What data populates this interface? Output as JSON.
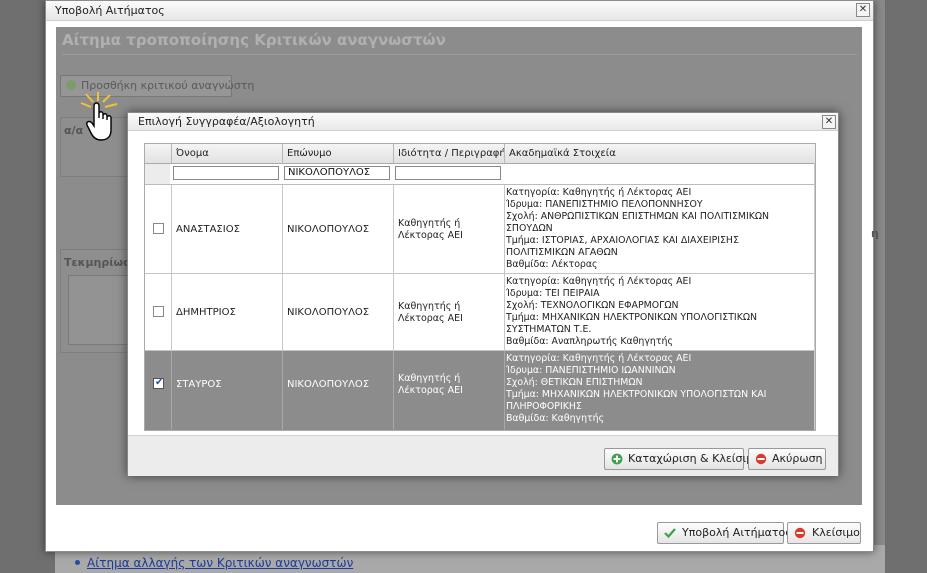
{
  "background_page": {
    "link_text": "Αίτημα αλλαγής των Κριτικών αναγνωστών"
  },
  "outer_dialog": {
    "title": "Υποβολή Αιτήματος",
    "heading": "Αίτημα τροποποίησης Κριτικών αναγνωστών",
    "add_reviewer_label": "Προσθήκη κριτικού αναγνώστη",
    "box1_label": "α/α",
    "box2_label": "Τεκμηρίωση",
    "right_label": "η",
    "submit_label": "Υποβολή Αιτήματος",
    "close_label": "Κλείσιμο"
  },
  "inner_dialog": {
    "title": "Επιλογή Συγγραφέα/Αξιολογητή",
    "columns": [
      "Όνομα",
      "Επώνυμο",
      "Ιδιότητα / Περιγραφή",
      "Ακαδημαϊκά Στοιχεία"
    ],
    "filters": {
      "first_name": "",
      "last_name": "ΝΙΚΟΛΟΠΟΥΛΟΣ",
      "role": ""
    },
    "rows": [
      {
        "selected": false,
        "first_name": "ΑΝΑΣΤΑΣΙΟΣ",
        "last_name": "ΝΙΚΟΛΟΠΟΥΛΟΣ",
        "role": "Καθηγητής ή Λέκτορας ΑΕΙ",
        "academic": [
          "Κατηγορία: Καθηγητής ή Λέκτορας ΑΕΙ",
          "Ίδρυμα: ΠΑΝΕΠΙΣΤΗΜΙΟ ΠΕΛΟΠΟΝΝΗΣΟΥ",
          "Σχολή: ΑΝΘΡΩΠΙΣΤΙΚΩΝ ΕΠΙΣΤΗΜΩΝ ΚΑΙ ΠΟΛΙΤΙΣΜΙΚΩΝ ΣΠΟΥΔΩΝ",
          "Τμήμα: ΙΣΤΟΡΙΑΣ, ΑΡΧΑΙΟΛΟΓΙΑΣ ΚΑΙ ΔΙΑΧΕΙΡΙΣΗΣ ΠΟΛΙΤΙΣΜΙΚΩΝ ΑΓΑΘΩΝ",
          "Βαθμίδα: Λέκτορας"
        ]
      },
      {
        "selected": false,
        "first_name": "ΔΗΜΗΤΡΙΟΣ",
        "last_name": "ΝΙΚΟΛΟΠΟΥΛΟΣ",
        "role": "Καθηγητής ή Λέκτορας ΑΕΙ",
        "academic": [
          "Κατηγορία: Καθηγητής ή Λέκτορας ΑΕΙ",
          "Ίδρυμα: ΤΕΙ ΠΕΙΡΑΙΑ",
          "Σχολή: ΤΕΧΝΟΛΟΓΙΚΩΝ ΕΦΑΡΜΟΓΩΝ",
          "Τμήμα: ΜΗΧΑΝΙΚΩΝ ΗΛΕΚΤΡΟΝΙΚΩΝ ΥΠΟΛΟΓΙΣΤΙΚΩΝ ΣΥΣΤΗΜΑΤΩΝ Τ.Ε.",
          "Βαθμίδα: Αναπληρωτής Καθηγητής"
        ]
      },
      {
        "selected": true,
        "first_name": "ΣΤΑΥΡΟΣ",
        "last_name": "ΝΙΚΟΛΟΠΟΥΛΟΣ",
        "role": "Καθηγητής ή Λέκτορας ΑΕΙ",
        "academic": [
          "Κατηγορία: Καθηγητής ή Λέκτορας ΑΕΙ",
          "Ίδρυμα: ΠΑΝΕΠΙΣΤΗΜΙΟ ΙΩΑΝΝΙΝΩΝ",
          "Σχολή: ΘΕΤΙΚΩΝ ΕΠΙΣΤΗΜΩΝ",
          "Τμήμα: ΜΗΧΑΝΙΚΩΝ ΗΛΕΚΤΡΟΝΙΚΩΝ ΥΠΟΛΟΓΙΣΤΩΝ ΚΑΙ ΠΛΗΡΟΦΟΡΙΚΗΣ",
          "Βαθμίδα: Καθηγητής"
        ]
      }
    ],
    "save_close_label": "Καταχώριση & Κλείσιμο",
    "cancel_label": "Ακύρωση"
  },
  "colors": {
    "overlay": "#8c8c8c",
    "selected_row": "#8c8c8c",
    "link": "#1c3c9c",
    "ok_icon": "#3da14a",
    "cancel_icon": "#d83a2c"
  },
  "icons": {
    "add": "plus-circle-icon",
    "submit": "checkmark-icon",
    "close": "no-entry-icon",
    "save": "plus-circle-icon",
    "cancel": "no-entry-icon",
    "cursor": "hand-pointer-icon"
  }
}
